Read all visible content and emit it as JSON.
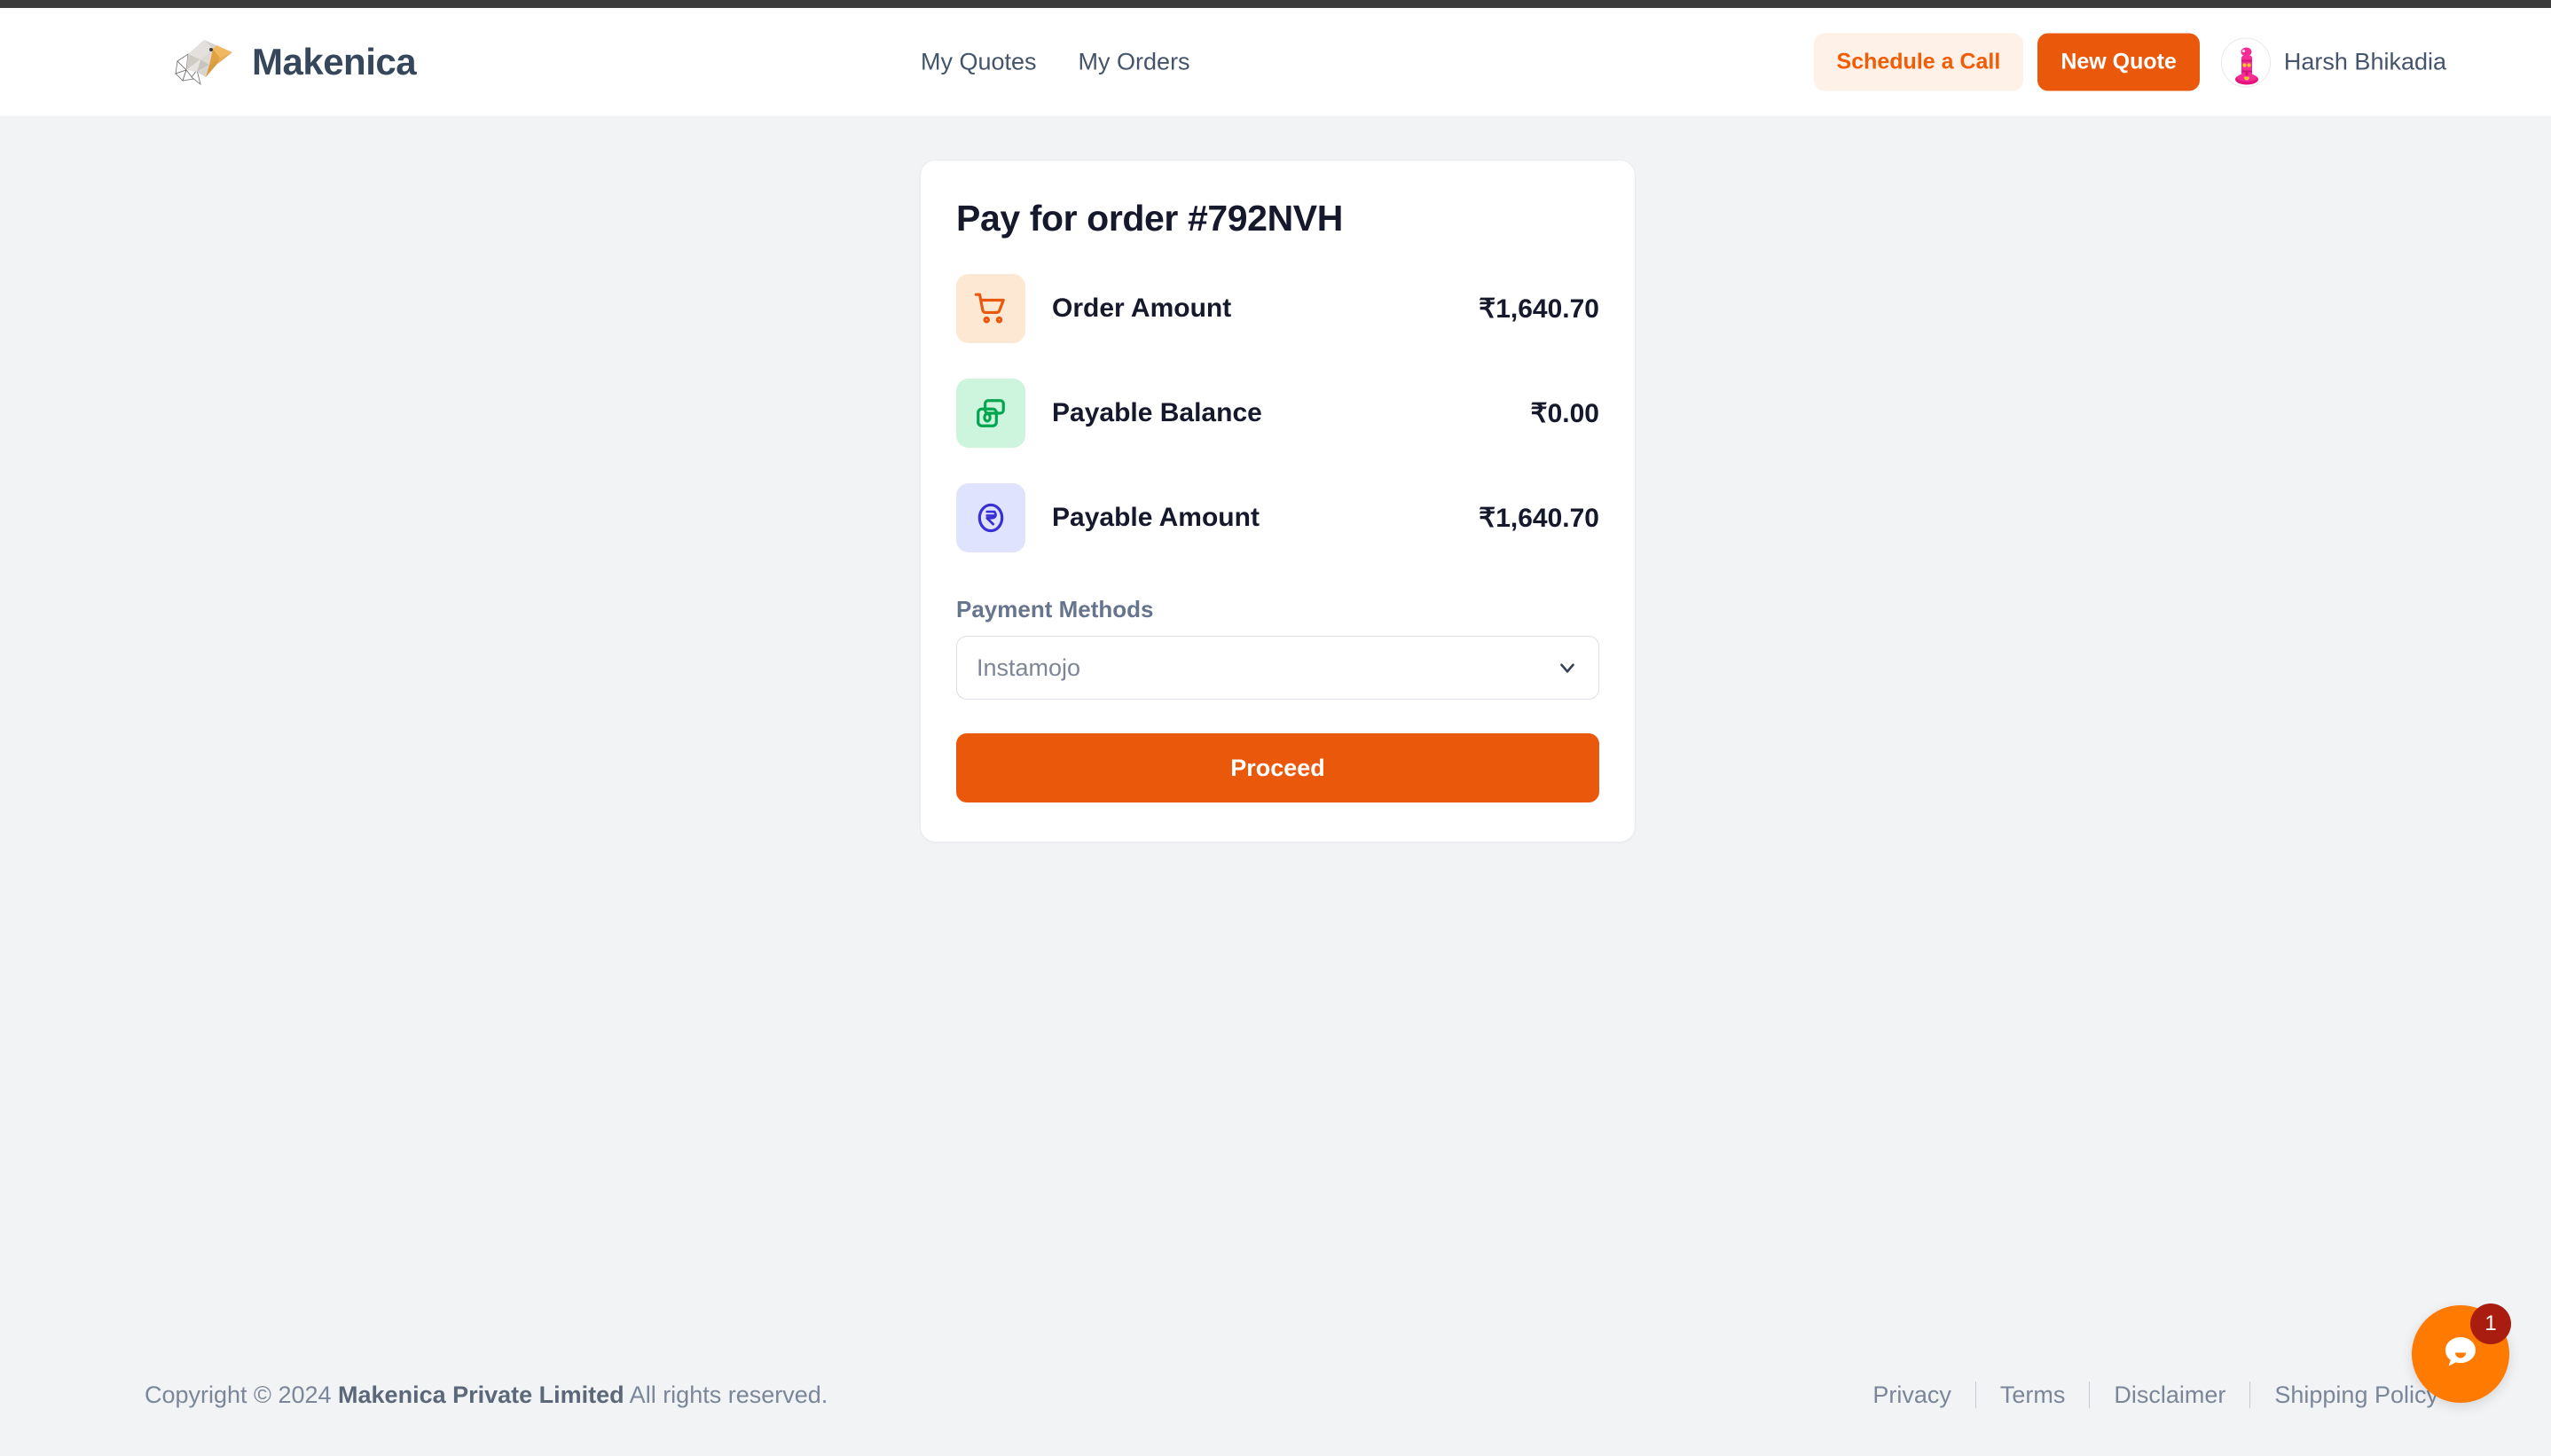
{
  "header": {
    "brand_name": "Makenica",
    "logo_icon": "eagle-head-logo",
    "nav": [
      {
        "label": "My Quotes"
      },
      {
        "label": "My Orders"
      }
    ],
    "schedule_call_label": "Schedule a Call",
    "new_quote_label": "New Quote",
    "user_name": "Harsh Bhikadia",
    "avatar_icon": "pink-robot-avatar",
    "accent_color": "#ea580c",
    "schedule_bg_color": "#fef1e7"
  },
  "card": {
    "title": "Pay for order #792NVH",
    "rows": [
      {
        "label": "Order Amount",
        "value": "₹1,640.70",
        "icon": "shopping-cart-icon",
        "icon_color": "#ea580c",
        "icon_bg": "#fde8d3"
      },
      {
        "label": "Payable Balance",
        "value": "₹0.00",
        "icon": "wallet-icon",
        "icon_color": "#00a550",
        "icon_bg": "#cdf4dd"
      },
      {
        "label": "Payable Amount",
        "value": "₹1,640.70",
        "icon": "rupee-coin-icon",
        "icon_color": "#3730d6",
        "icon_bg": "#dfe3fd"
      }
    ],
    "payment_methods_label": "Payment Methods",
    "payment_method_selected": "Instamojo",
    "payment_method_options": [
      "Instamojo"
    ],
    "chevron_icon": "chevron-down-icon",
    "proceed_label": "Proceed"
  },
  "footer": {
    "copyright_prefix": "Copyright © 2024 ",
    "company": "Makenica Private Limited",
    "copyright_suffix": " All rights reserved.",
    "links": [
      {
        "label": "Privacy"
      },
      {
        "label": "Terms"
      },
      {
        "label": "Disclaimer"
      },
      {
        "label": "Shipping Policy"
      }
    ]
  },
  "chat": {
    "icon": "chat-bubble-icon",
    "badge_count": "1",
    "button_color": "#ff7a00",
    "badge_color": "#a81d10"
  }
}
